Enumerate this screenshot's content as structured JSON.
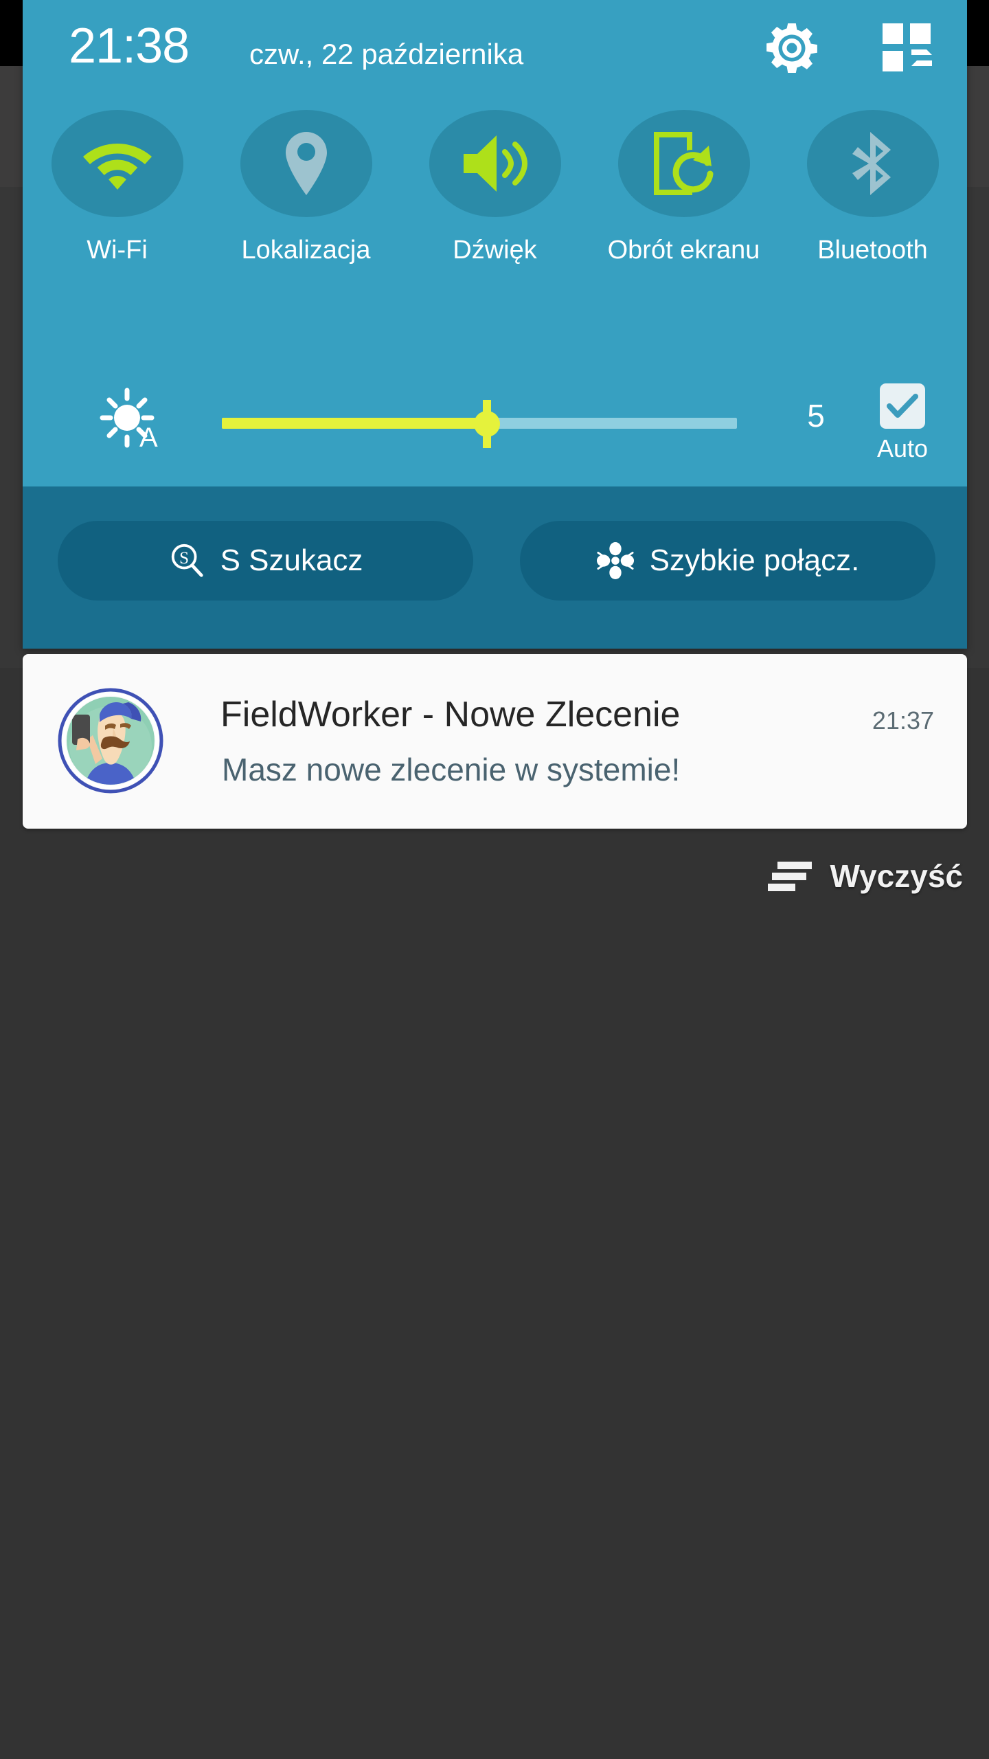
{
  "status_bar": {
    "clock": "21:38",
    "date": "czw., 22 października"
  },
  "header_actions": {
    "settings": {
      "label": "Ustawienia",
      "icon": "gear-icon"
    },
    "edit_quick_settings": {
      "label": "Edytuj",
      "icon": "quick-settings-grid-icon"
    }
  },
  "quick_toggles": [
    {
      "label": "Wi-Fi",
      "icon": "wifi-icon",
      "active": true
    },
    {
      "label": "Lokalizacja",
      "icon": "location-pin-icon",
      "active": false
    },
    {
      "label": "Dźwięk",
      "icon": "sound-speaker-icon",
      "active": true
    },
    {
      "label": "Obrót ekranu",
      "icon": "screen-rotation-icon",
      "active": true
    },
    {
      "label": "Bluetooth",
      "icon": "bluetooth-icon",
      "active": false
    }
  ],
  "brightness": {
    "icon": "brightness-auto-icon",
    "value": "5",
    "percent": 51,
    "auto_label": "Auto",
    "auto_checked": true
  },
  "shortcuts": [
    {
      "label": "S Szukacz",
      "icon": "s-finder-icon"
    },
    {
      "label": "Szybkie połącz.",
      "icon": "quick-connect-icon"
    }
  ],
  "notifications": [
    {
      "app_icon": "fieldworker-avatar-icon",
      "title": "FieldWorker - Nowe Zlecenie",
      "body": "Masz nowe zlecenie w systemie!",
      "time": "21:37"
    }
  ],
  "clear_button": {
    "label": "Wyczyść",
    "icon": "clear-all-icon"
  },
  "colors": {
    "panel_bg": "#37a0c1",
    "panel_bottom_bg": "#1a6f8f",
    "toggle_circle": "#2b8ba8",
    "accent_active": "#aee01a",
    "accent_slider": "#e5f23c",
    "inactive_icon": "#9dc3cf",
    "pill_bg": "#116180",
    "notification_bg": "#fafafa",
    "screen_bg": "#333333"
  }
}
